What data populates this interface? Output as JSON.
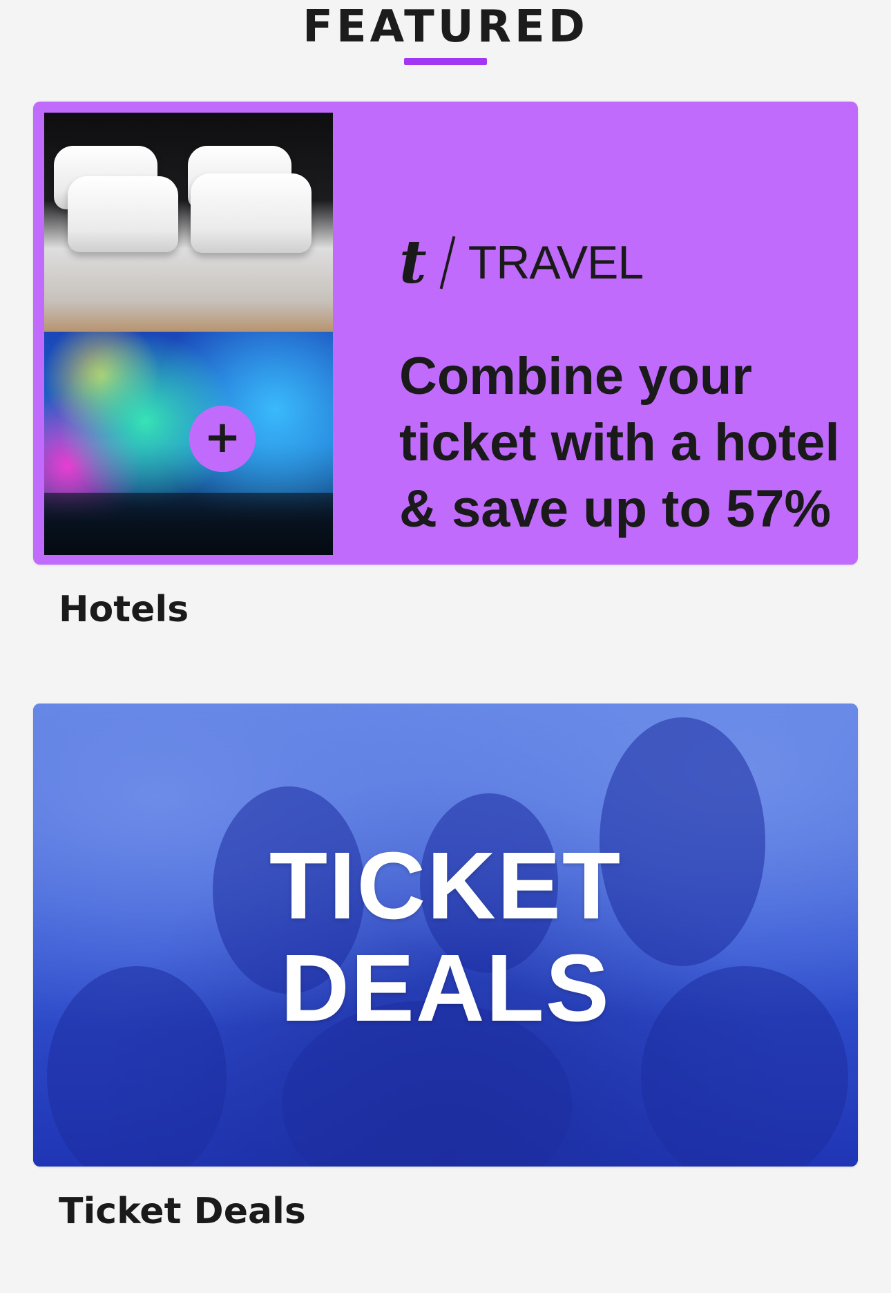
{
  "section": {
    "title": "FEATURED",
    "accent_color": "#a236f2"
  },
  "cards": [
    {
      "label": "Hotels",
      "background_color": "#c16bfc",
      "brand_mark": "t",
      "brand_text": "TRAVEL",
      "plus_symbol": "+",
      "headline": "Combine your ticket with a hotel & save up to 57%"
    },
    {
      "label": "Ticket Deals",
      "background_color": "#2d4ed0",
      "title_line1": "TICKET",
      "title_line2": "DEALS"
    }
  ]
}
